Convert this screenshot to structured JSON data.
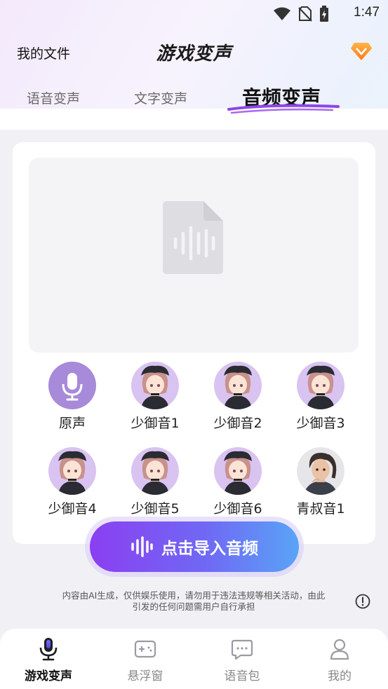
{
  "status_bar": {
    "time": "1:47",
    "icons": [
      "wifi-icon",
      "no-sim-icon",
      "battery-charging-icon"
    ]
  },
  "header": {
    "left_link": "我的文件",
    "title": "游戏变声",
    "right_icon": "vip-diamond-icon"
  },
  "tabs": [
    {
      "label": "语音变声",
      "active": false
    },
    {
      "label": "文字变声",
      "active": false
    },
    {
      "label": "音频变声",
      "active": true
    }
  ],
  "preview": {
    "icon": "audio-file-icon"
  },
  "voices": [
    {
      "label": "原声",
      "avatar": "microphone-icon"
    },
    {
      "label": "少御音1",
      "avatar": "anime-girl-avatar"
    },
    {
      "label": "少御音2",
      "avatar": "anime-girl-avatar"
    },
    {
      "label": "少御音3",
      "avatar": "anime-girl-avatar"
    },
    {
      "label": "少御音4",
      "avatar": "anime-girl-avatar"
    },
    {
      "label": "少御音5",
      "avatar": "anime-girl-avatar"
    },
    {
      "label": "少御音6",
      "avatar": "anime-girl-avatar"
    },
    {
      "label": "青叔音1",
      "avatar": "anime-man-avatar"
    }
  ],
  "import_button": {
    "label": "点击导入音频",
    "icon": "sound-wave-icon"
  },
  "disclaimer": {
    "line1": "内容由AI生成，仅供娱乐使用，请勿用于违法违规等相关活动，由此",
    "line2": "引发的任何问题需用户自行承担"
  },
  "bottom_nav": [
    {
      "label": "游戏变声",
      "icon": "microphone-icon",
      "active": true
    },
    {
      "label": "悬浮窗",
      "icon": "gamepad-icon",
      "active": false
    },
    {
      "label": "语音包",
      "icon": "chat-bubble-icon",
      "active": false
    },
    {
      "label": "我的",
      "icon": "person-icon",
      "active": false
    }
  ],
  "colors": {
    "accent_purple": "#8b3ff1",
    "accent_blue": "#59a4f7",
    "avatar_bg": "#d9c3f1",
    "original_voice_bg": "#a78ad9"
  }
}
